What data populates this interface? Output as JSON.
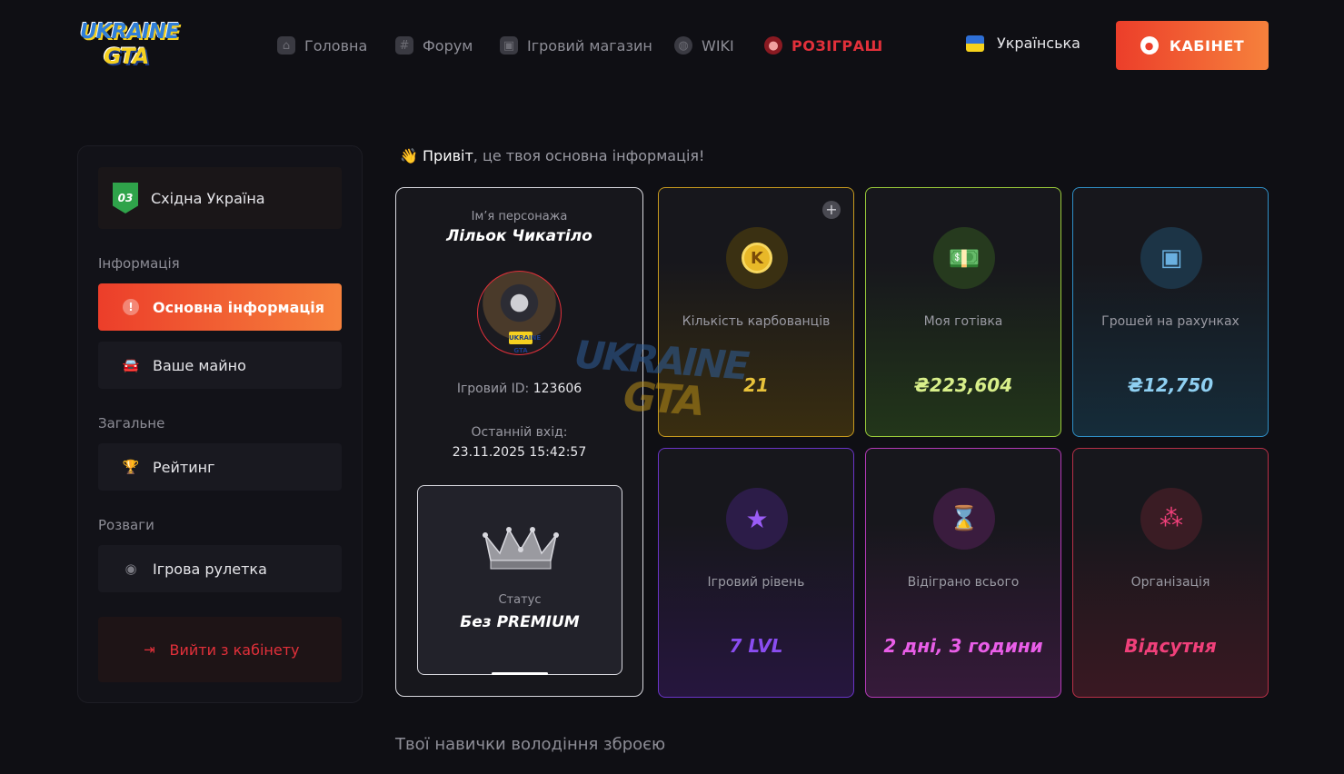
{
  "brand": {
    "logo_line1": "UKRAINE",
    "logo_line2": "GTA"
  },
  "nav": [
    {
      "label": "Головна",
      "icon": "home-icon"
    },
    {
      "label": "Форум",
      "icon": "hash-icon"
    },
    {
      "label": "Ігровий магазин",
      "icon": "bag-icon"
    },
    {
      "label": "WIKI",
      "icon": "globe-icon"
    },
    {
      "label": "РОЗІГРАШ",
      "icon": "dice-icon",
      "color": "#e2303a"
    }
  ],
  "language": {
    "label": "Українська",
    "flag_colors": [
      "#2e6fd6",
      "#f6d21c"
    ]
  },
  "cabinet_button": {
    "label": "КАБІНЕТ",
    "gradient": [
      "#ec3e2a",
      "#f6813c"
    ]
  },
  "sidebar": {
    "server": {
      "badge": "03",
      "label": "Східна Україна"
    },
    "sections": [
      {
        "heading": "Інформація",
        "items": [
          {
            "label": "Основна інформація",
            "icon": "alert-circle-icon",
            "active": true
          },
          {
            "label": "Ваше майно",
            "icon": "car-icon",
            "active": false
          }
        ]
      },
      {
        "heading": "Загальне",
        "items": [
          {
            "label": "Рейтинг",
            "icon": "trophy-icon",
            "active": false
          }
        ]
      },
      {
        "heading": "Розваги",
        "items": [
          {
            "label": "Ігрова рулетка",
            "icon": "roulette-icon",
            "active": false
          }
        ]
      }
    ],
    "logout": {
      "label": "Вийти з кабінету",
      "icon": "logout-icon"
    }
  },
  "greeting": {
    "emoji": "👋",
    "hello": "Привіт",
    "rest": ", це твоя основна інформація!"
  },
  "character": {
    "name_label": "Ім’я персонажа",
    "name": "Лільок Чикатіло",
    "avatar_tag": "UKRAINE GTA",
    "id_label": "Ігровий ID:",
    "id": "123606",
    "last_login_label": "Останній вхід:",
    "last_login": "23.11.2025 15:42:57",
    "status_label": "Статус",
    "status": "Без PREMIUM"
  },
  "stats": [
    {
      "label": "Кількість карбованців",
      "value": "21",
      "icon": "coin-icon",
      "icon_text": "K",
      "color": "#e8c23a",
      "border": "#c79a1e",
      "has_plus": true
    },
    {
      "label": "Моя готівка",
      "value": "₴223,604",
      "icon": "cash-icon",
      "icon_text": "💵",
      "color": "#d8ef8a",
      "border": "#9acb3a",
      "has_plus": false
    },
    {
      "label": "Грошей на рахунках",
      "value": "₴12,750",
      "icon": "safe-icon",
      "icon_text": "▣",
      "color": "#8fd0f2",
      "border": "#2f8fc6",
      "has_plus": false
    },
    {
      "label": "Ігровий рівень",
      "value": "7 LVL",
      "icon": "star-icon",
      "icon_text": "★",
      "color": "#8a4df0",
      "border": "#6a34c8",
      "has_plus": false
    },
    {
      "label": "Відіграно всього",
      "value": "2 дні, 3 години",
      "icon": "hourglass-icon",
      "icon_text": "⌛",
      "color": "#e95ee8",
      "border": "#b43ab8",
      "has_plus": false
    },
    {
      "label": "Організація",
      "value": "Відсутня",
      "icon": "group-icon",
      "icon_text": "⁂",
      "color": "#f0407a",
      "border": "#b83048",
      "has_plus": false
    }
  ],
  "skills_heading": "Твої навички володіння зброєю"
}
